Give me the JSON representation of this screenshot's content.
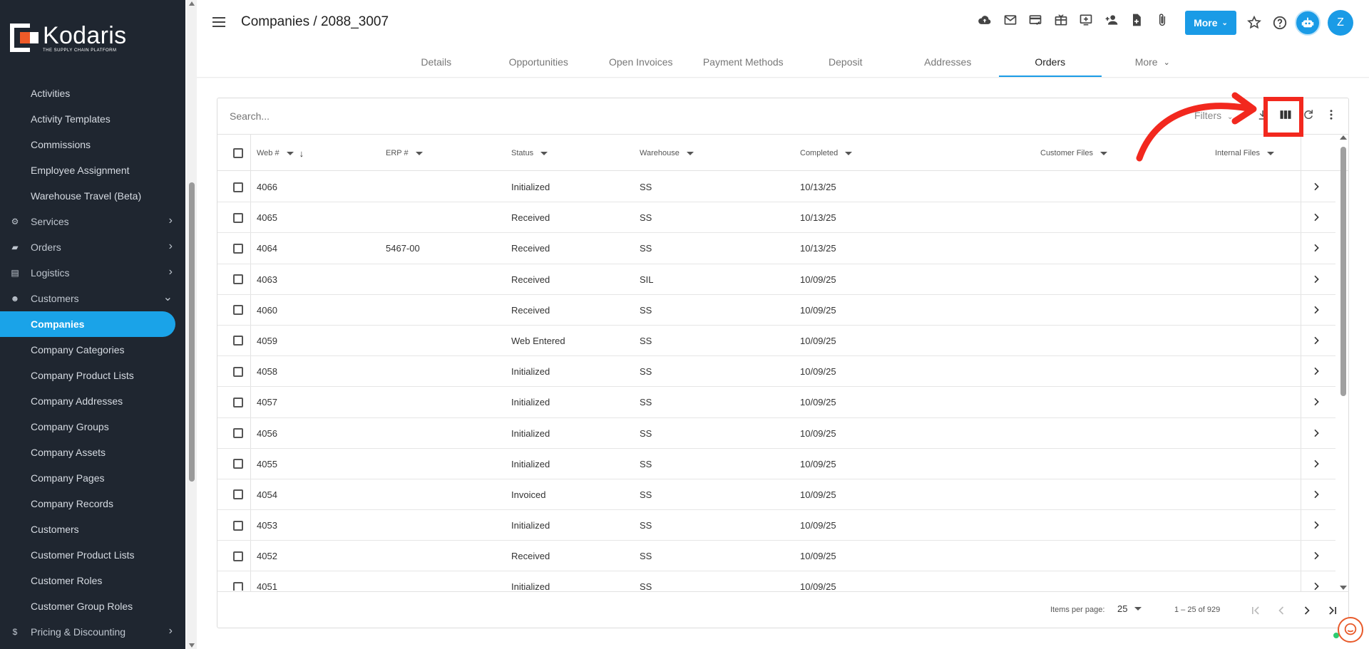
{
  "brand": {
    "name": "Kodaris",
    "tagline": "THE SUPPLY CHAIN PLATFORM",
    "accent": "#1a9be6",
    "sidebar_bg": "#1f2630"
  },
  "sidebar": {
    "items": [
      {
        "label": "Activities",
        "kind": "link"
      },
      {
        "label": "Activity Templates",
        "kind": "link"
      },
      {
        "label": "Commissions",
        "kind": "link"
      },
      {
        "label": "Employee Assignment",
        "kind": "link"
      },
      {
        "label": "Warehouse Travel (Beta)",
        "kind": "link"
      },
      {
        "label": "Services",
        "kind": "section",
        "icon": "gears-icon"
      },
      {
        "label": "Orders",
        "kind": "section",
        "icon": "truck-icon"
      },
      {
        "label": "Logistics",
        "kind": "section",
        "icon": "shipping-icon"
      },
      {
        "label": "Customers",
        "kind": "section-open",
        "icon": "people-icon"
      },
      {
        "label": "Companies",
        "kind": "active"
      },
      {
        "label": "Company Categories",
        "kind": "link"
      },
      {
        "label": "Company Product Lists",
        "kind": "link"
      },
      {
        "label": "Company Addresses",
        "kind": "link"
      },
      {
        "label": "Company Groups",
        "kind": "link"
      },
      {
        "label": "Company Assets",
        "kind": "link"
      },
      {
        "label": "Company Pages",
        "kind": "link"
      },
      {
        "label": "Company Records",
        "kind": "link"
      },
      {
        "label": "Customers",
        "kind": "link"
      },
      {
        "label": "Customer Product Lists",
        "kind": "link"
      },
      {
        "label": "Customer Roles",
        "kind": "link"
      },
      {
        "label": "Customer Group Roles",
        "kind": "link"
      },
      {
        "label": "Pricing & Discounting",
        "kind": "section",
        "icon": "dollar-icon"
      }
    ]
  },
  "header": {
    "title": "Companies / 2088_3007",
    "more_label": "More",
    "avatar_initial": "Z"
  },
  "tabs": [
    {
      "label": "Details"
    },
    {
      "label": "Opportunities"
    },
    {
      "label": "Open Invoices"
    },
    {
      "label": "Payment Methods"
    },
    {
      "label": "Deposit"
    },
    {
      "label": "Addresses"
    },
    {
      "label": "Orders",
      "active": true
    },
    {
      "label": "More"
    }
  ],
  "table": {
    "search_placeholder": "Search...",
    "filters_label": "Filters",
    "columns": [
      "Web #",
      "ERP #",
      "Status",
      "Warehouse",
      "Completed",
      "Customer Files",
      "Internal Files"
    ],
    "rows": [
      {
        "web": "4066",
        "erp": "",
        "status": "Initialized",
        "warehouse": "SS",
        "completed": "10/13/25"
      },
      {
        "web": "4065",
        "erp": "",
        "status": "Received",
        "warehouse": "SS",
        "completed": "10/13/25"
      },
      {
        "web": "4064",
        "erp": "5467-00",
        "status": "Received",
        "warehouse": "SS",
        "completed": "10/13/25"
      },
      {
        "web": "4063",
        "erp": "",
        "status": "Received",
        "warehouse": "SIL",
        "completed": "10/09/25"
      },
      {
        "web": "4060",
        "erp": "",
        "status": "Received",
        "warehouse": "SS",
        "completed": "10/09/25"
      },
      {
        "web": "4059",
        "erp": "",
        "status": "Web Entered",
        "warehouse": "SS",
        "completed": "10/09/25"
      },
      {
        "web": "4058",
        "erp": "",
        "status": "Initialized",
        "warehouse": "SS",
        "completed": "10/09/25"
      },
      {
        "web": "4057",
        "erp": "",
        "status": "Initialized",
        "warehouse": "SS",
        "completed": "10/09/25"
      },
      {
        "web": "4056",
        "erp": "",
        "status": "Initialized",
        "warehouse": "SS",
        "completed": "10/09/25"
      },
      {
        "web": "4055",
        "erp": "",
        "status": "Initialized",
        "warehouse": "SS",
        "completed": "10/09/25"
      },
      {
        "web": "4054",
        "erp": "",
        "status": "Invoiced",
        "warehouse": "SS",
        "completed": "10/09/25"
      },
      {
        "web": "4053",
        "erp": "",
        "status": "Initialized",
        "warehouse": "SS",
        "completed": "10/09/25"
      },
      {
        "web": "4052",
        "erp": "",
        "status": "Received",
        "warehouse": "SS",
        "completed": "10/09/25"
      },
      {
        "web": "4051",
        "erp": "",
        "status": "Initialized",
        "warehouse": "SS",
        "completed": "10/09/25"
      }
    ],
    "items_per_page_label": "Items per page:",
    "items_per_page": "25",
    "range_label": "1 – 25 of 929"
  },
  "annotation": {
    "color": "#f2281e"
  }
}
